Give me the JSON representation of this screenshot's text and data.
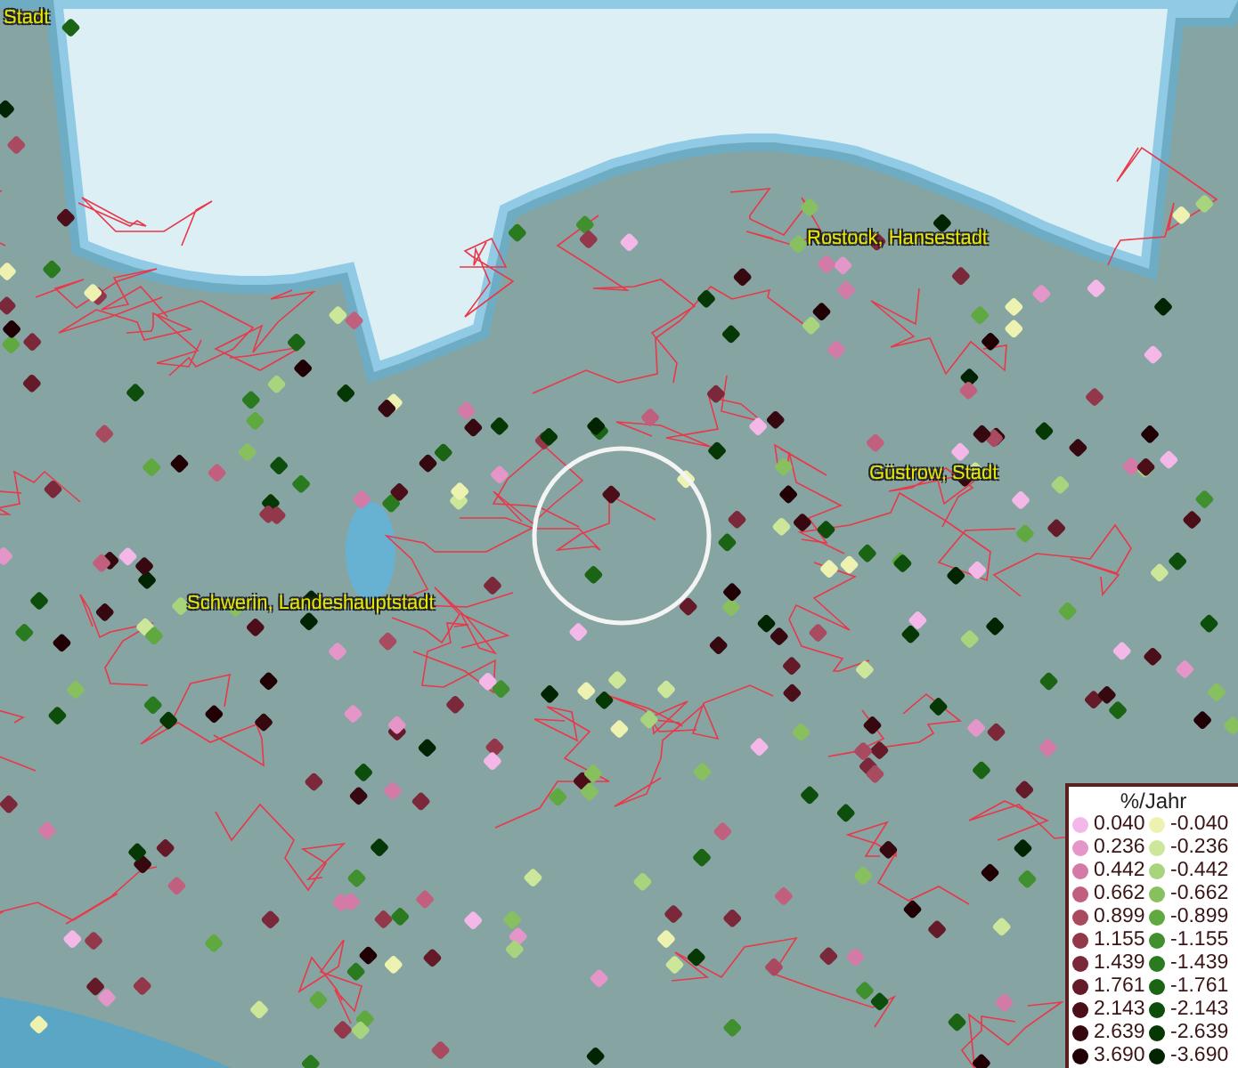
{
  "map": {
    "place_labels": [
      "Stadt",
      "Rostock, Hansestadt",
      "Güstrow, Stadt",
      "Schwerin, Landeshauptstadt"
    ]
  },
  "legend": {
    "title": "%/Jahr",
    "positive": [
      {
        "label": "0.040",
        "color": "#f4b8e8"
      },
      {
        "label": "0.236",
        "color": "#e496c8"
      },
      {
        "label": "0.442",
        "color": "#d47aa6"
      },
      {
        "label": "0.662",
        "color": "#c0607e"
      },
      {
        "label": "0.899",
        "color": "#a84a60"
      },
      {
        "label": "1.155",
        "color": "#92384a"
      },
      {
        "label": "1.439",
        "color": "#7a283a"
      },
      {
        "label": "1.761",
        "color": "#641a28"
      },
      {
        "label": "2.143",
        "color": "#4c0e18"
      },
      {
        "label": "2.639",
        "color": "#360810"
      },
      {
        "label": "3.690",
        "color": "#200004"
      }
    ],
    "negative": [
      {
        "label": "-0.040",
        "color": "#eef2b0"
      },
      {
        "label": "-0.236",
        "color": "#cce69a"
      },
      {
        "label": "-0.442",
        "color": "#a8d47e"
      },
      {
        "label": "-0.662",
        "color": "#88c060"
      },
      {
        "label": "-0.899",
        "color": "#60a840"
      },
      {
        "label": "-1.155",
        "color": "#409030"
      },
      {
        "label": "-1.439",
        "color": "#2a7a20"
      },
      {
        "label": "-1.761",
        "color": "#1a6414"
      },
      {
        "label": "-2.143",
        "color": "#0e4e0c"
      },
      {
        "label": "-2.639",
        "color": "#063806"
      },
      {
        "label": "-3.690",
        "color": "#022402"
      }
    ]
  }
}
